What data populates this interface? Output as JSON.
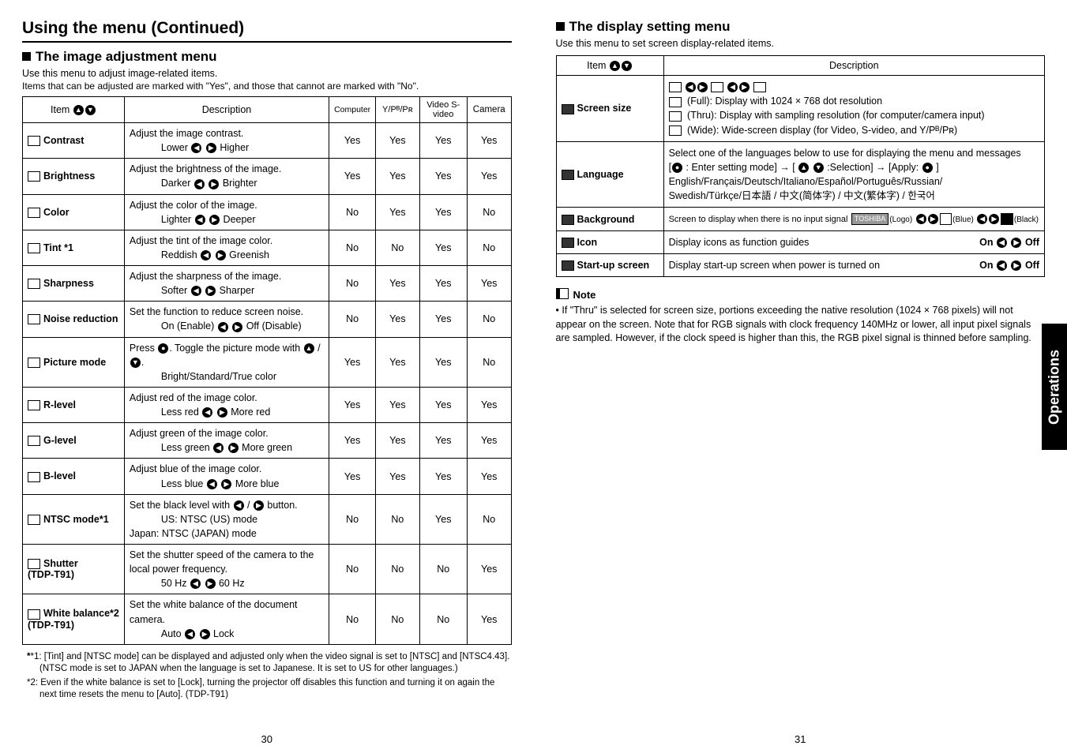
{
  "left": {
    "page_title": "Using the menu (Continued)",
    "section_title": "The image adjustment menu",
    "sub1": "Use this menu to adjust image-related items.",
    "sub2": "Items that can be adjusted are marked with  \"Yes\", and those that cannot are marked with \"No\".",
    "th_item": "Item",
    "th_desc": "Description",
    "th_c1": "Computer",
    "th_c2": "Y/Pᴮ/Pʀ",
    "th_c3": "Video S-video",
    "th_c4": "Camera",
    "rows": [
      {
        "item": "Contrast",
        "desc": "Adjust the image contrast.",
        "lr": "Lower  ◀ ▶  Higher",
        "c1": "Yes",
        "c2": "Yes",
        "c3": "Yes",
        "c4": "Yes"
      },
      {
        "item": "Brightness",
        "desc": "Adjust the brightness of the image.",
        "lr": "Darker  ◀ ▶  Brighter",
        "c1": "Yes",
        "c2": "Yes",
        "c3": "Yes",
        "c4": "Yes"
      },
      {
        "item": "Color",
        "desc": "Adjust the color of the image.",
        "lr": "Lighter  ◀ ▶  Deeper",
        "c1": "No",
        "c2": "Yes",
        "c3": "Yes",
        "c4": "No"
      },
      {
        "item": "Tint *1",
        "desc": "Adjust the tint of the image color.",
        "lr": "Reddish  ◀ ▶  Greenish",
        "c1": "No",
        "c2": "No",
        "c3": "Yes",
        "c4": "No"
      },
      {
        "item": "Sharpness",
        "desc": "Adjust the sharpness of the image.",
        "lr": "Softer  ◀ ▶  Sharper",
        "c1": "No",
        "c2": "Yes",
        "c3": "Yes",
        "c4": "Yes"
      },
      {
        "item": "Noise reduction",
        "desc": "Set the function to reduce screen noise.",
        "lr": "On (Enable)  ◀ ▶  Off (Disable)",
        "c1": "No",
        "c2": "Yes",
        "c3": "Yes",
        "c4": "No"
      },
      {
        "item": "Picture mode",
        "desc": "Press ●. Toggle the picture mode with ▲ / ▼.",
        "lr": "Bright/Standard/True color",
        "c1": "Yes",
        "c2": "Yes",
        "c3": "Yes",
        "c4": "No"
      },
      {
        "item": "R-level",
        "desc": "Adjust red of the image color.",
        "lr": "Less red  ◀ ▶  More red",
        "c1": "Yes",
        "c2": "Yes",
        "c3": "Yes",
        "c4": "Yes"
      },
      {
        "item": "G-level",
        "desc": "Adjust green of the image color.",
        "lr": "Less green  ◀ ▶  More green",
        "c1": "Yes",
        "c2": "Yes",
        "c3": "Yes",
        "c4": "Yes"
      },
      {
        "item": "B-level",
        "desc": "Adjust blue of the image color.",
        "lr": "Less blue  ◀ ▶  More blue",
        "c1": "Yes",
        "c2": "Yes",
        "c3": "Yes",
        "c4": "Yes"
      },
      {
        "item": "NTSC mode*1",
        "desc": "Set the black level with ◀ / ▶ button.",
        "lr": "US:      NTSC (US) mode\nJapan:  NTSC (JAPAN) mode",
        "c1": "No",
        "c2": "No",
        "c3": "Yes",
        "c4": "No"
      },
      {
        "item": "Shutter\n(TDP-T91)",
        "desc": "Set the shutter speed of the camera to the local power frequency.",
        "lr": "50 Hz  ◀ ▶  60 Hz",
        "c1": "No",
        "c2": "No",
        "c3": "No",
        "c4": "Yes"
      },
      {
        "item": "White balance*2\n(TDP-T91)",
        "desc": "Set the white balance of the document camera.",
        "lr": "Auto  ◀ ▶  Lock",
        "c1": "No",
        "c2": "No",
        "c3": "No",
        "c4": "Yes"
      }
    ],
    "foot1": "*1: [Tint] and [NTSC mode] can be displayed and adjusted only when the video signal is set to [NTSC] and [NTSC4.43]. (NTSC mode is set to JAPAN when the language is set to Japanese. It is set to US for other languages.)",
    "foot2": "*2: Even if the white balance is set to [Lock], turning  the projector off disables this function and turning it on again the next time resets the menu to [Auto]. (TDP-T91)",
    "pagenum": "30"
  },
  "right": {
    "section_title": "The display setting menu",
    "sub1": "Use this menu to set screen display-related items.",
    "th_item": "Item",
    "th_desc": "Description",
    "rows": [
      {
        "item": "Screen size",
        "desc_lines": [
          "(Full):  Display with 1024 × 768 dot resolution",
          "(Thru): Display with sampling resolution (for computer/camera input)",
          "(Wide): Wide-screen display (for Video, S-video, and Y/Pᴮ/Pʀ)"
        ],
        "icons_row": true
      },
      {
        "item": "Language",
        "desc_lines": [
          "Select one of the languages below to use for displaying the menu and messages",
          "[● : Enter setting mode] → [ ▲ ▼ :Selection] → [Apply: ● ]",
          "English/Français/Deutsch/Italiano/Español/Português/Russian/",
          "Swedish/Türkçe/日本語 / 中文(简体字) / 中文(繁体字) / 한국어"
        ]
      },
      {
        "item": "Background",
        "bg_row": true,
        "desc": "Screen to display when there is no input signal"
      },
      {
        "item": "Icon",
        "desc": "Display icons as function guides",
        "onoff": "On ◀ ▶ Off"
      },
      {
        "item": "Start-up screen",
        "desc": "Display start-up screen when power is turned on",
        "onoff": "On ◀ ▶ Off"
      }
    ],
    "note_title": "Note",
    "note_body": "• If \"Thru\" is selected for screen size, portions exceeding the native resolution (1024 × 768 pixels) will not appear on the screen. Note that for RGB signals with clock frequency 140MHz or lower, all input pixel signals are sampled. However, if the clock speed is higher than this, the RGB pixel signal is thinned before sampling.",
    "pagenum": "31",
    "sidetab": "Operations"
  }
}
